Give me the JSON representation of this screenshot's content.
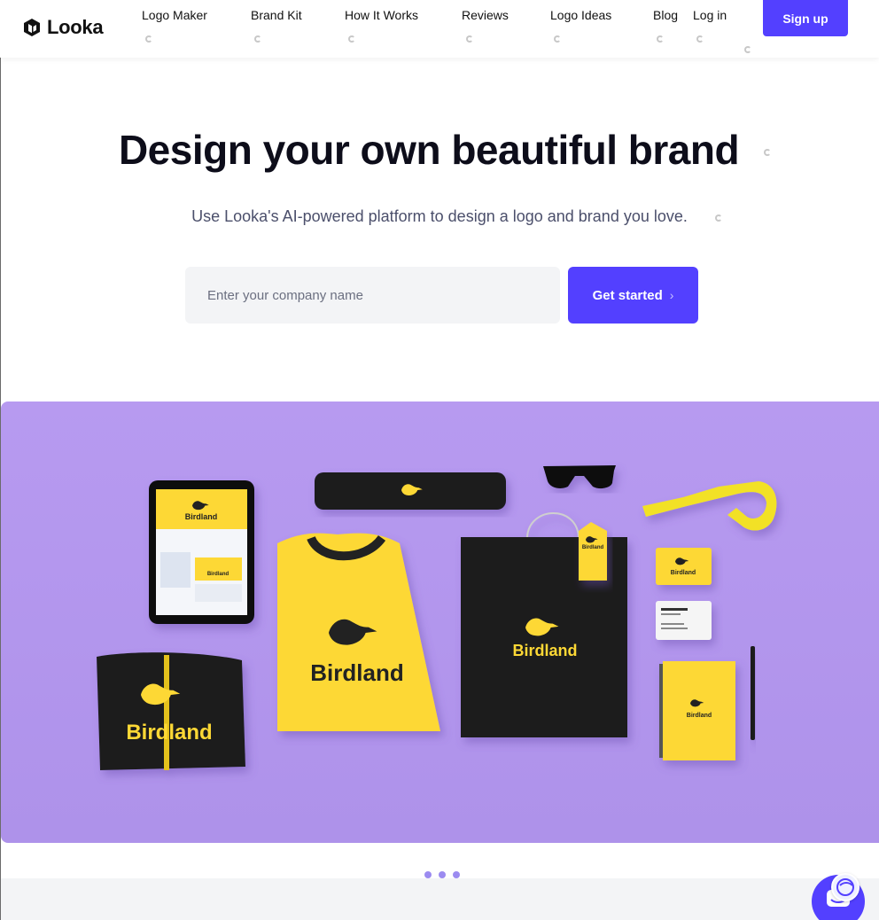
{
  "brand": {
    "name": "Looka",
    "accent_color": "#5340ff",
    "logo_icon": "looka-hexagon-icon"
  },
  "nav": {
    "items": [
      {
        "label": "Logo Maker"
      },
      {
        "label": "Brand Kit"
      },
      {
        "label": "How It Works"
      },
      {
        "label": "Reviews"
      },
      {
        "label": "Logo Ideas"
      },
      {
        "label": "Blog"
      }
    ],
    "login_label": "Log in",
    "signup_label": "Sign up"
  },
  "hero": {
    "title": "Design your own beautiful brand",
    "subtitle": "Use Looka's AI-powered platform to design a logo and brand you love.",
    "input_placeholder": "Enter your company name",
    "input_value": "",
    "cta_label": "Get started",
    "cta_icon": "chevron-right-icon"
  },
  "showcase": {
    "brand_text": "Birdland",
    "background_color": "#b79af0",
    "mockup_color": "#fdd835",
    "dark_color": "#222222"
  },
  "carousel": {
    "dots": 3
  },
  "chat": {
    "icon": "chat-icon"
  }
}
